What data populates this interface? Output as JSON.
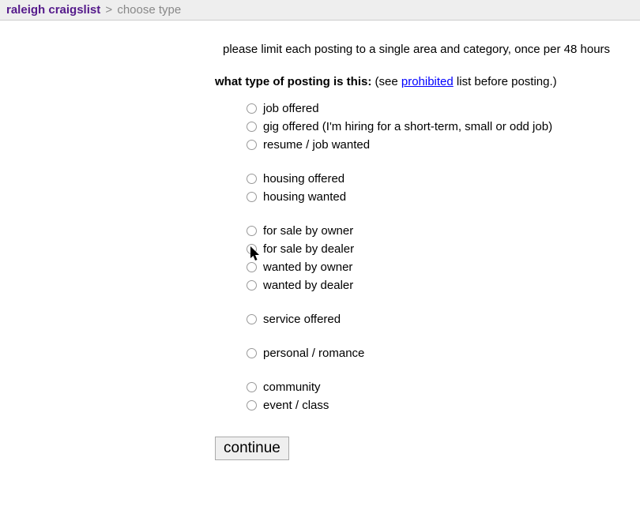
{
  "breadcrumb": {
    "site_label": "raleigh craigslist",
    "separator": ">",
    "current": "choose type"
  },
  "notice": "please limit each posting to a single area and category, once per 48 hours",
  "question": {
    "bold": "what type of posting is this:",
    "paren_open": " (see ",
    "prohibited": "prohibited",
    "paren_close": " list before posting.)"
  },
  "groups": [
    {
      "items": [
        {
          "label": "job offered"
        },
        {
          "label": "gig offered (I'm hiring for a short-term, small or odd job)"
        },
        {
          "label": "resume / job wanted"
        }
      ]
    },
    {
      "items": [
        {
          "label": "housing offered"
        },
        {
          "label": "housing wanted"
        }
      ]
    },
    {
      "items": [
        {
          "label": "for sale by owner"
        },
        {
          "label": "for sale by dealer"
        },
        {
          "label": "wanted by owner"
        },
        {
          "label": "wanted by dealer"
        }
      ]
    },
    {
      "items": [
        {
          "label": "service offered"
        }
      ]
    },
    {
      "items": [
        {
          "label": "personal / romance"
        }
      ]
    },
    {
      "items": [
        {
          "label": "community"
        },
        {
          "label": "event / class"
        }
      ]
    }
  ],
  "continue_label": "continue"
}
